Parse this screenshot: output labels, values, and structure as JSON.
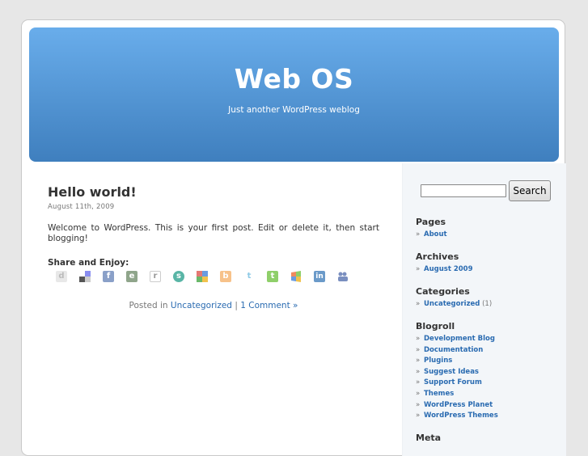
{
  "header": {
    "title": "Web OS",
    "description": "Just another WordPress weblog"
  },
  "post": {
    "title": "Hello world!",
    "date": "August 11th, 2009",
    "body": "Welcome to WordPress. This is your first post. Edit or delete it, then start blogging!",
    "share_title": "Share and Enjoy:",
    "share_icons": [
      "digg-icon",
      "delicious-icon",
      "facebook-icon",
      "evernote-icon",
      "reddit-icon",
      "stumbleupon-icon",
      "google-icon",
      "blogger-icon",
      "twitter-icon",
      "technorati-icon",
      "windows-live-icon",
      "linkedin-icon",
      "myspace-icon"
    ],
    "meta_prefix": "Posted in",
    "category": "Uncategorized",
    "separator": "|",
    "comments": "1 Comment »"
  },
  "sidebar": {
    "search_button": "Search",
    "pages": {
      "heading": "Pages",
      "items": [
        "About"
      ]
    },
    "archives": {
      "heading": "Archives",
      "items": [
        "August 2009"
      ]
    },
    "categories": {
      "heading": "Categories",
      "items": [
        {
          "label": "Uncategorized",
          "count": "(1)"
        }
      ]
    },
    "blogroll": {
      "heading": "Blogroll",
      "items": [
        "Development Blog",
        "Documentation",
        "Plugins",
        "Suggest Ideas",
        "Support Forum",
        "Themes",
        "WordPress Planet",
        "WordPress Themes"
      ]
    },
    "meta": {
      "heading": "Meta"
    }
  },
  "colors": {
    "header_top": "#69adeb",
    "header_bottom": "#3f7fbe",
    "link": "#2a6bb1",
    "sidebar_bg": "#f3f6f9"
  }
}
